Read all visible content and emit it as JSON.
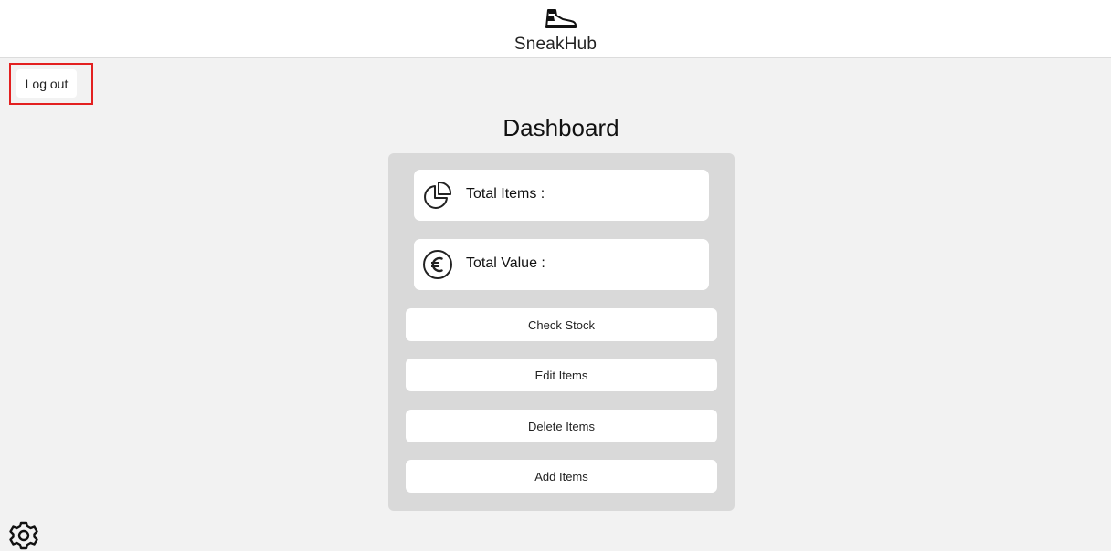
{
  "header": {
    "brand": "SneakHub",
    "logo_icon": "sneaker-icon"
  },
  "logout": {
    "label": "Log out",
    "highlight_color": "#e32020"
  },
  "main": {
    "title": "Dashboard",
    "stats": [
      {
        "icon": "pie-chart-icon",
        "label": "Total Items :"
      },
      {
        "icon": "euro-icon",
        "label": "Total Value :"
      }
    ],
    "actions": [
      {
        "label": "Check Stock"
      },
      {
        "label": "Edit Items"
      },
      {
        "label": "Delete Items"
      },
      {
        "label": "Add Items"
      }
    ]
  },
  "footer": {
    "settings_icon": "gear-icon"
  },
  "colors": {
    "page_background": "#f2f2f2",
    "panel_background": "#d9d9d9",
    "card_background": "#ffffff"
  }
}
